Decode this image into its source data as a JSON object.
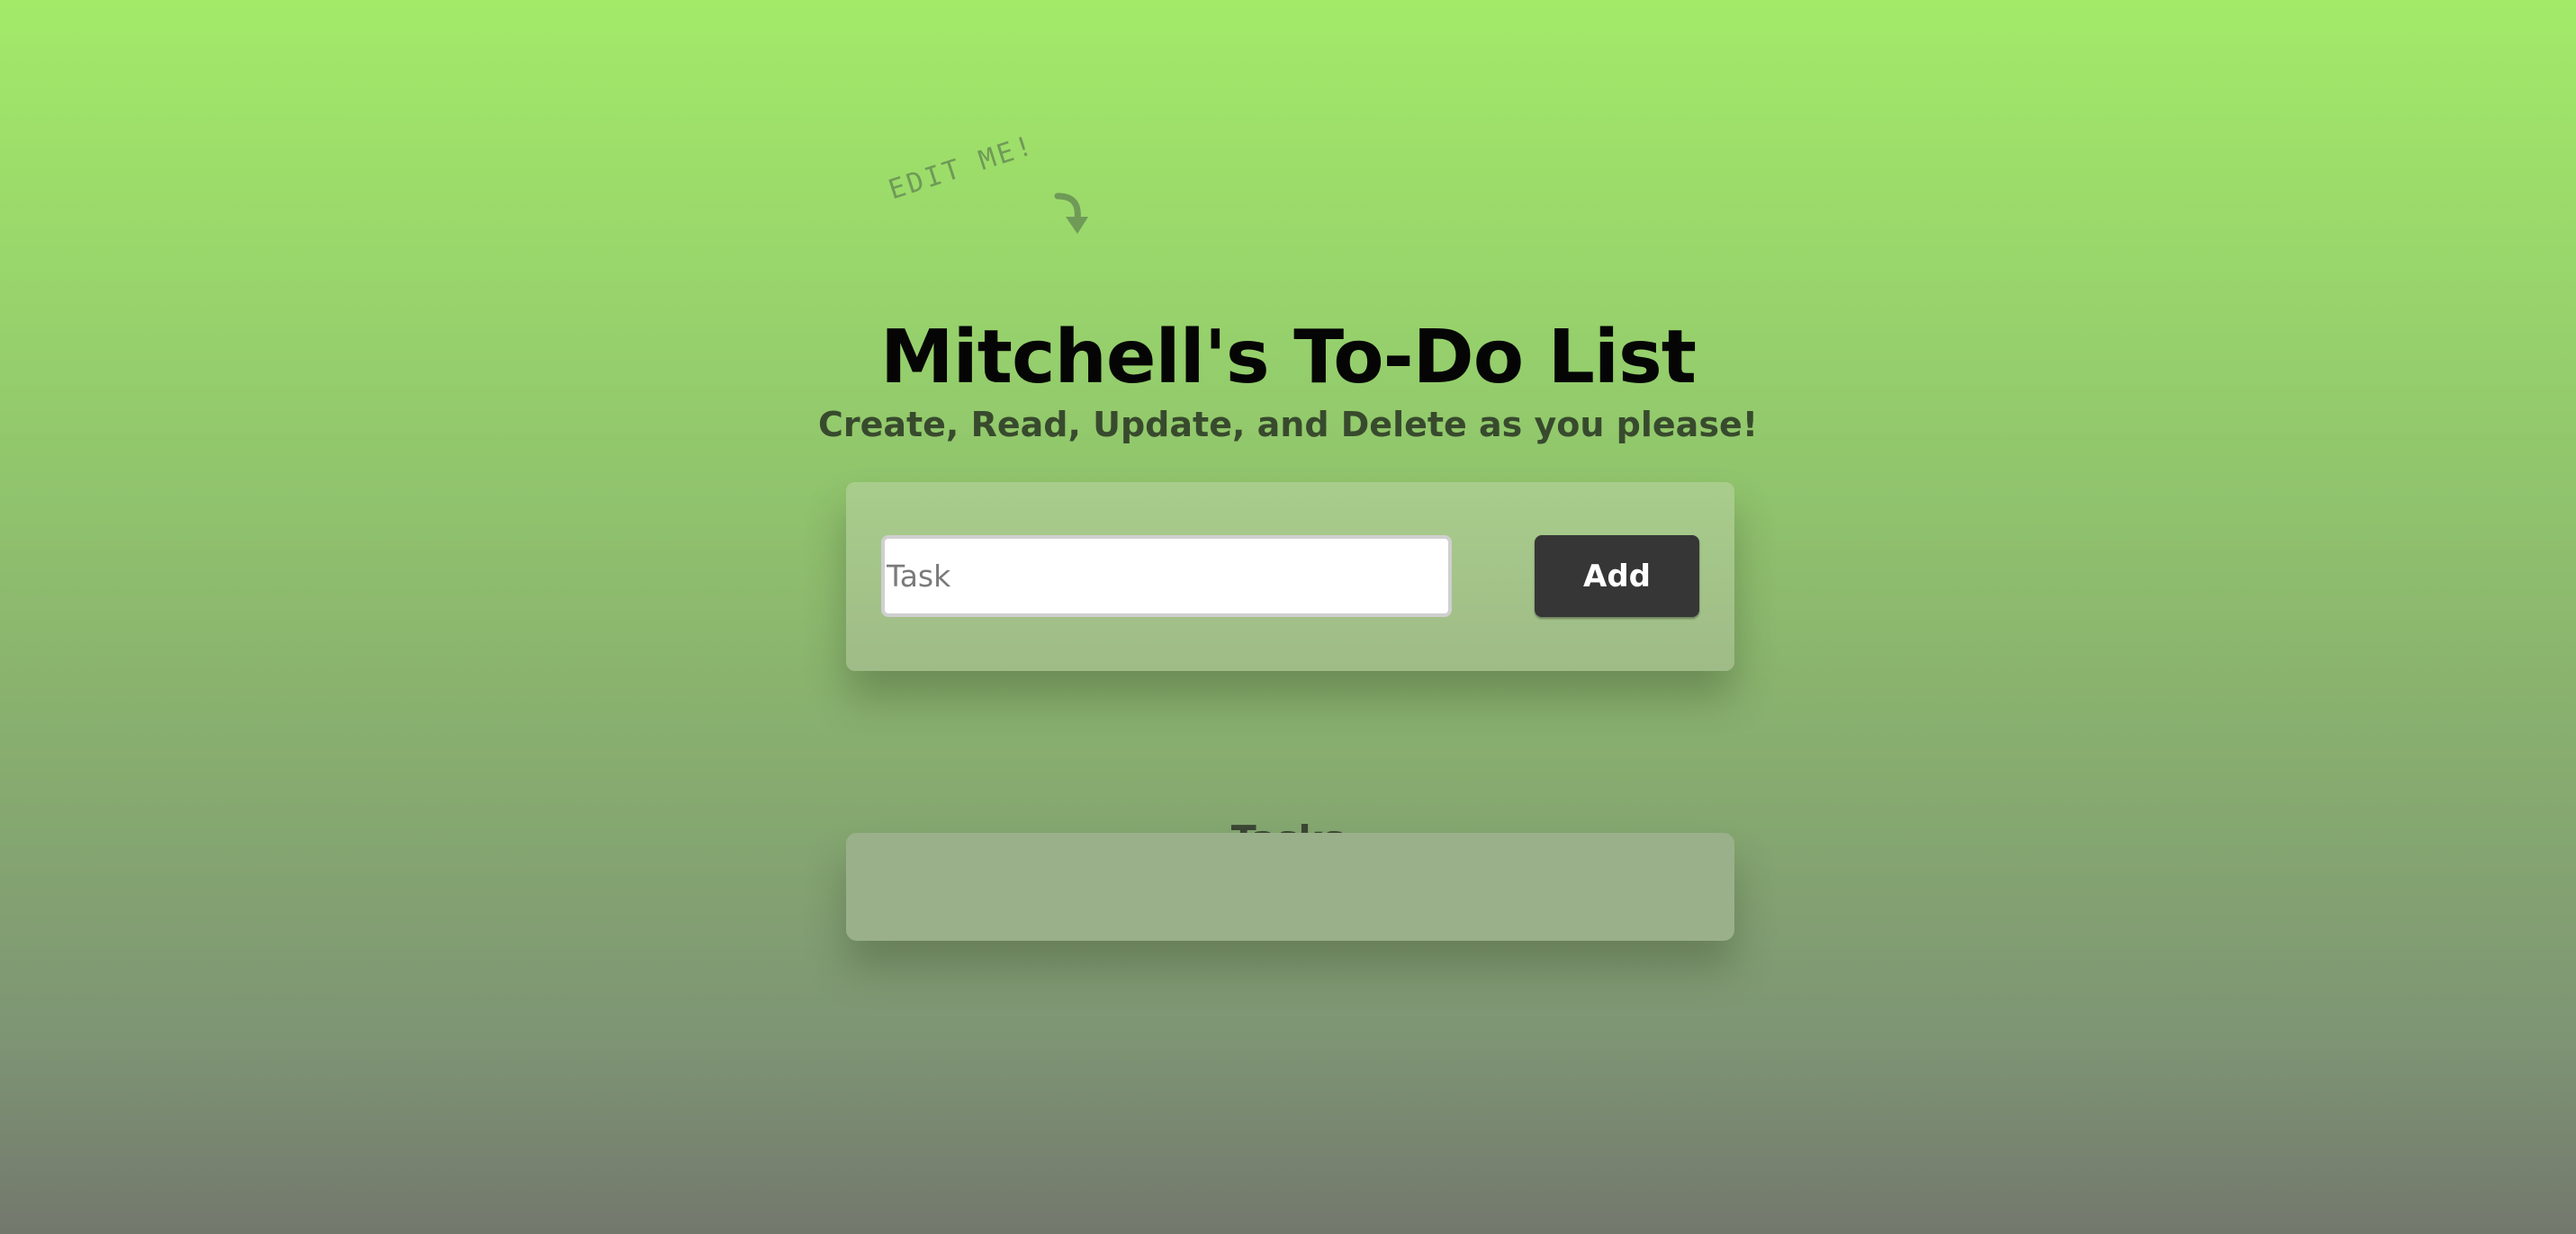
{
  "header": {
    "edit_note": "EDIT ME!",
    "arrow_icon": "curved-arrow-down-icon",
    "title": "Mitchell's To-Do List",
    "subtitle": "Create, Read, Update, and Delete as you please!"
  },
  "form": {
    "task_value": "",
    "task_placeholder": "Task",
    "add_label": "Add"
  },
  "tasks": {
    "heading": "Tasks",
    "items": []
  },
  "colors": {
    "background_top": "#a3ea69",
    "background_bottom": "#73786d",
    "panel": "#a3c487",
    "tasks_panel": "#9ab08a",
    "button": "#363636",
    "title": "#050505",
    "subtitle": "#384a2d",
    "edit_note": "#6f9a57"
  }
}
